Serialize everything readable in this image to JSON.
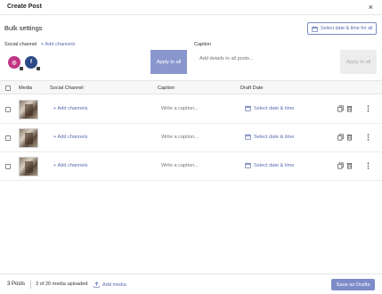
{
  "modal": {
    "title": "Create Post",
    "close_symbol": "×"
  },
  "bulk": {
    "title": "Bulk settings",
    "select_all_label": "Select date & time for all",
    "social_channel_label": "Social channel",
    "add_channels_label": "+ Add channels",
    "caption_label": "Caption",
    "apply_label_1": "Apply to all",
    "caption_placeholder": "Add details to all posts...",
    "apply_label_2": "Apply to all",
    "channels": [
      {
        "name": "instagram",
        "glyph": "◎",
        "color": "#c13584"
      },
      {
        "name": "facebook",
        "glyph": "f",
        "color": "#2d4a86"
      }
    ]
  },
  "table": {
    "headers": {
      "media": "Media",
      "social_channel": "Social Channel",
      "caption": "Caption",
      "draft_date": "Draft Date"
    },
    "rows": [
      {
        "add_channels": "+ Add channels",
        "caption_placeholder": "Write a caption...",
        "date_label": "Select date & time"
      },
      {
        "add_channels": "+ Add channels",
        "caption_placeholder": "Write a caption...",
        "date_label": "Select date & time"
      },
      {
        "add_channels": "+ Add channels",
        "caption_placeholder": "Write a caption...",
        "date_label": "Select date & time"
      }
    ]
  },
  "footer": {
    "posts_count": "3 Posts",
    "uploaded_text": "3 of 20 media uploaded",
    "add_media_label": "Add media",
    "save_draft_label": "Save as Drafts"
  },
  "colors": {
    "accent": "#5a6bb0",
    "primary_button": "#7d8cc8"
  }
}
